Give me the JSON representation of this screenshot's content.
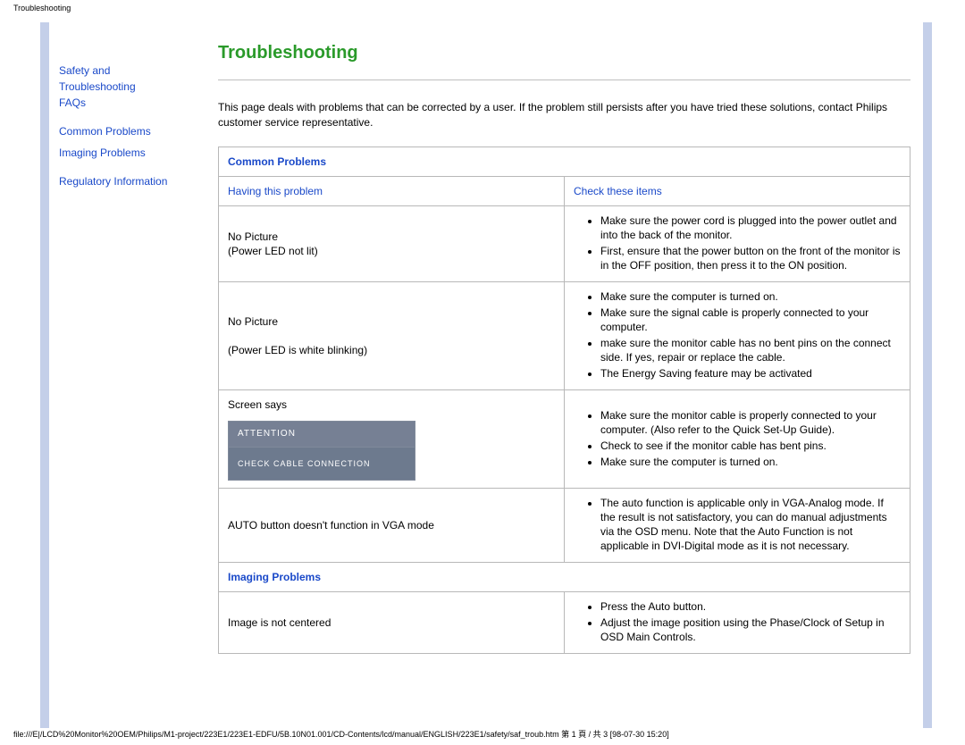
{
  "browser_tab": "Troubleshooting",
  "footer_path": "file:///E|/LCD%20Monitor%20OEM/Philips/M1-project/223E1/223E1-EDFU/5B.10N01.001/CD-Contents/lcd/manual/ENGLISH/223E1/safety/saf_troub.htm 第 1 頁 / 共 3  [98-07-30 15:20]",
  "sidebar": {
    "item0a": "Safety and",
    "item0b": "Troubleshooting",
    "item1": "FAQs",
    "item2": "Common Problems",
    "item3": "Imaging Problems",
    "item4": "Regulatory Information"
  },
  "title": "Troubleshooting",
  "intro": "This page deals with problems that can be corrected by a user. If the problem still persists after you have tried these solutions, contact Philips customer service representative.",
  "table": {
    "section1": "Common Problems",
    "col_left": "Having this problem",
    "col_right": "Check these items",
    "row1_problem_a": "No Picture",
    "row1_problem_b": "(Power LED not lit)",
    "row1_checks": [
      "Make sure the power cord is plugged into the power outlet and into the back of the monitor.",
      "First, ensure that the power button on the front of the monitor is in the OFF position, then press it to the ON position."
    ],
    "row2_problem_a": "No Picture",
    "row2_problem_b": "(Power LED is white blinking)",
    "row2_checks": [
      "Make sure the computer is turned on.",
      "Make sure the signal cable is properly connected to your computer.",
      "make sure the monitor cable has no bent pins on the connect side. If yes, repair or replace the cable.",
      "The Energy Saving feature may be activated"
    ],
    "row3_problem": "Screen says",
    "row3_box_head": "ATTENTION",
    "row3_box_body": "CHECK CABLE CONNECTION",
    "row3_checks": [
      "Make sure the monitor cable is properly connected to your computer. (Also refer to the Quick Set-Up Guide).",
      "Check to see if the monitor cable has bent pins.",
      "Make sure the computer is turned on."
    ],
    "row4_problem": "AUTO button doesn't function in VGA mode",
    "row4_checks": [
      "The auto function is applicable only in VGA-Analog mode.  If the result is not satisfactory, you can do manual adjustments via the OSD menu.  Note that the Auto Function is not applicable in DVI-Digital mode as it is not necessary."
    ],
    "section2": "Imaging Problems",
    "row5_problem": "Image is not centered",
    "row5_checks": [
      "Press the Auto button.",
      "Adjust the image position using the Phase/Clock of Setup in OSD Main Controls."
    ]
  }
}
